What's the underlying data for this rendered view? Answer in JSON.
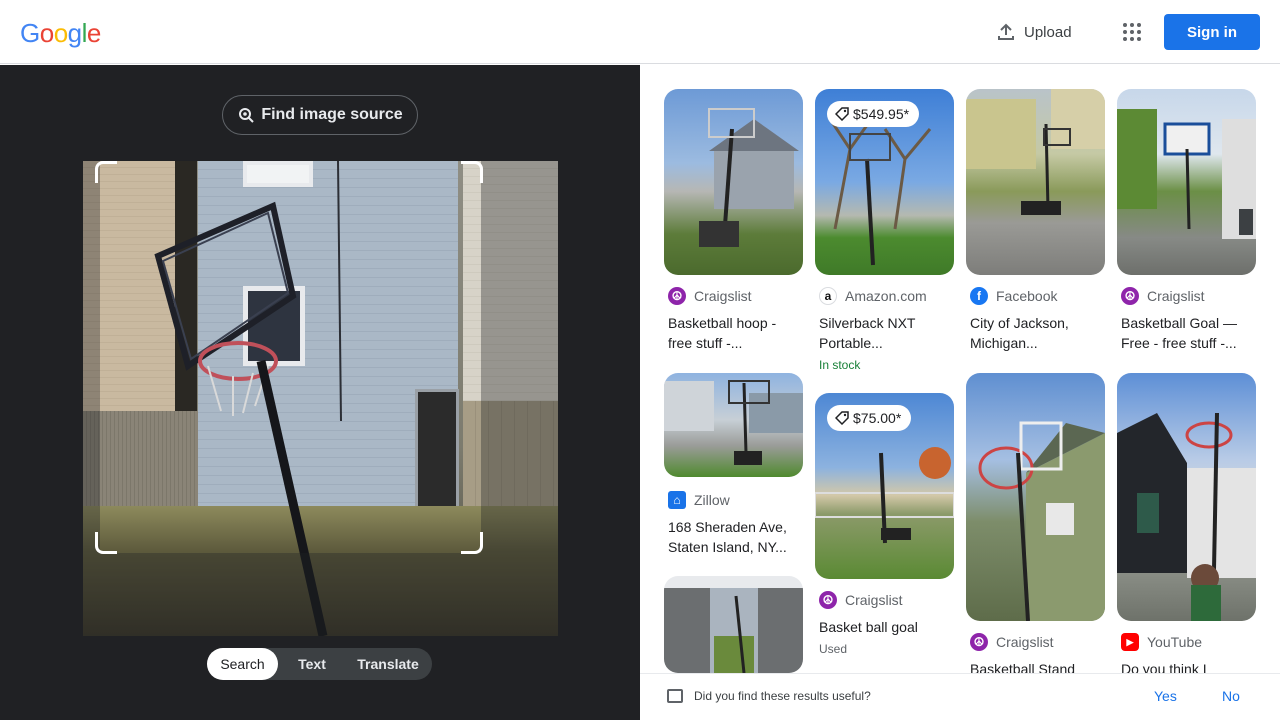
{
  "header": {
    "logo_letters": [
      {
        "ch": "G",
        "color": "#4285F4"
      },
      {
        "ch": "o",
        "color": "#EA4335"
      },
      {
        "ch": "o",
        "color": "#FBBC05"
      },
      {
        "ch": "g",
        "color": "#4285F4"
      },
      {
        "ch": "l",
        "color": "#34A853"
      },
      {
        "ch": "e",
        "color": "#EA4335"
      }
    ],
    "upload_label": "Upload",
    "upload_icon": "upload-icon",
    "apps_icon": "apps-grid-icon",
    "signin_label": "Sign in"
  },
  "lens": {
    "find_source_label": "Find image source",
    "modes": [
      "Search",
      "Text",
      "Translate"
    ],
    "active_mode": "Search"
  },
  "results": [
    {
      "source": "Craigslist",
      "icon": "peace-icon",
      "title_lines": [
        "Basketball hoop -",
        "free stuff -..."
      ],
      "sub": "",
      "price": ""
    },
    {
      "source": "Amazon.com",
      "icon": "amazon-icon",
      "title_lines": [
        "Silverback NXT",
        "Portable..."
      ],
      "sub": "In stock",
      "price": "$549.95*"
    },
    {
      "source": "Facebook",
      "icon": "facebook-icon",
      "title_lines": [
        "City of Jackson,",
        "Michigan..."
      ],
      "sub": "",
      "price": ""
    },
    {
      "source": "Craigslist",
      "icon": "peace-icon",
      "title_lines": [
        "Basketball Goal —",
        "Free - free stuff -..."
      ],
      "sub": "",
      "price": ""
    },
    {
      "source": "Zillow",
      "icon": "zillow-icon",
      "title_lines": [
        "168 Sheraden Ave,",
        "Staten Island, NY..."
      ],
      "sub": "",
      "price": ""
    },
    {
      "source": "Craigslist",
      "icon": "peace-icon",
      "title_lines": [
        "Basket ball goal"
      ],
      "sub": "Used",
      "price": "$75.00*"
    },
    {
      "source": "Craigslist",
      "icon": "peace-icon",
      "title_lines": [
        "Basketball Stand"
      ],
      "sub": "",
      "price": ""
    },
    {
      "source": "YouTube",
      "icon": "youtube-icon",
      "title_lines": [
        "Do you think I"
      ],
      "sub": "",
      "price": ""
    }
  ],
  "feedback": {
    "question": "Did you find these results useful?",
    "yes": "Yes",
    "no": "No"
  }
}
